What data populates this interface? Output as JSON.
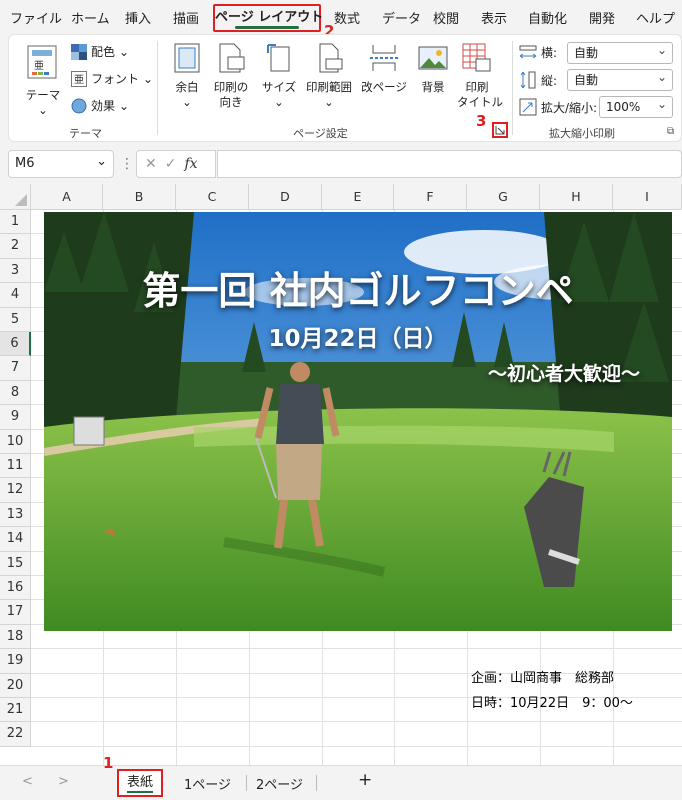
{
  "menu": {
    "items": [
      "ファイル",
      "ホーム",
      "挿入",
      "描画",
      "ページ レイアウト",
      "数式",
      "データ",
      "校閲",
      "表示",
      "自動化",
      "開発",
      "ヘルプ"
    ]
  },
  "callouts": {
    "one": "1",
    "two": "2",
    "three": "3"
  },
  "ribbon": {
    "theme_group": {
      "themes": "テーマ",
      "colors": "配色",
      "fonts": "フォント",
      "effects": "効果",
      "label": "テーマ"
    },
    "page_setup_group": {
      "margins": "余白",
      "orientation_line1": "印刷の",
      "orientation_line2": "向き",
      "size": "サイズ",
      "print_area": "印刷範囲",
      "breaks": "改ページ",
      "background": "背景",
      "print_titles_line1": "印刷",
      "print_titles_line2": "タイトル",
      "label": "ページ設定"
    },
    "scale_group": {
      "width_label": "横:",
      "width_value": "自動",
      "height_label": "縦:",
      "height_value": "自動",
      "scale_label": "拡大/縮小:",
      "scale_value": "100%",
      "label": "拡大縮小印刷"
    }
  },
  "formula_bar": {
    "name_box": "M6",
    "fx": "fx"
  },
  "columns": [
    "A",
    "B",
    "C",
    "D",
    "E",
    "F",
    "G",
    "H",
    "I"
  ],
  "rows": [
    "1",
    "2",
    "3",
    "4",
    "5",
    "6",
    "7",
    "8",
    "9",
    "10",
    "11",
    "12",
    "13",
    "14",
    "15",
    "16",
    "17",
    "18",
    "19",
    "20",
    "21",
    "22"
  ],
  "banner": {
    "title": "第一回 社内ゴルフコンペ",
    "date": "10月22日（日）",
    "subtitle": "～初心者大歓迎～"
  },
  "info": {
    "planner": "企画：山岡商事　総務部",
    "datetime": "日時：10月22日　9：00～"
  },
  "sheet_tabs": {
    "active": "表紙",
    "tab2": "1ページ",
    "tab3": "2ページ",
    "add": "+"
  },
  "colors": {
    "accent_green": "#1e7145",
    "highlight_red": "#e02020"
  }
}
